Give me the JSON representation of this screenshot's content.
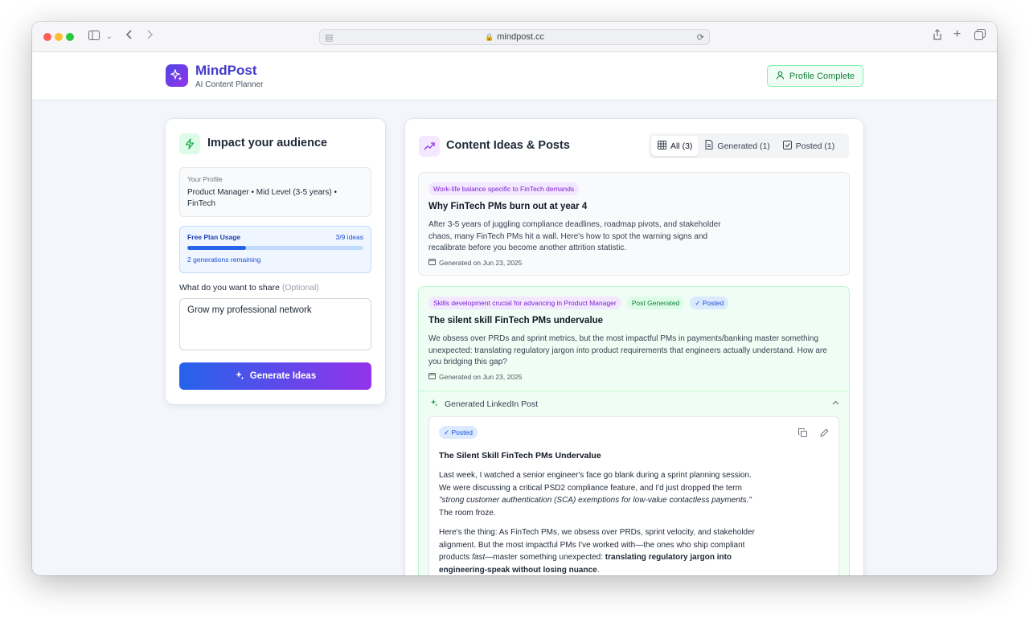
{
  "browser": {
    "url": "mindpost.cc"
  },
  "header": {
    "brand_title": "MindPost",
    "brand_subtitle": "AI Content Planner",
    "profile_button": "Profile Complete"
  },
  "left_panel": {
    "title": "Impact your audience",
    "profile_label": "Your Profile",
    "profile_value": "Product Manager • Mid Level (3-5 years) • FinTech",
    "usage_title": "Free Plan Usage",
    "usage_count": "3/9 ideas",
    "usage_fraction": 0.3333,
    "usage_remaining": "2 generations remaining",
    "share_label": "What do you want to share",
    "share_optional": "(Optional)",
    "share_value": "Grow my professional network",
    "generate_button": "Generate Ideas"
  },
  "right_panel": {
    "title": "Content Ideas & Posts",
    "tabs": [
      {
        "label": "All (3)"
      },
      {
        "label": "Generated (1)"
      },
      {
        "label": "Posted (1)"
      }
    ],
    "ideas": [
      {
        "tag": "Work-life balance specific to FinTech demands",
        "title": "Why FinTech PMs burn out at year 4",
        "body": "After 3-5 years of juggling compliance deadlines, roadmap pivots, and stakeholder chaos, many FinTech PMs hit a wall. Here's how to spot the warning signs and recalibrate before you become another attrition statistic.",
        "date": "Generated on Jun 23, 2025"
      },
      {
        "tag": "Skills development crucial for advancing in Product Manager",
        "status_generated": "Post Generated",
        "status_posted": "✓ Posted",
        "title": "The silent skill FinTech PMs undervalue",
        "body": "We obsess over PRDs and sprint metrics, but the most impactful PMs in payments/banking master something unexpected: translating regulatory jargon into product requirements that engineers actually understand. How are you bridging this gap?",
        "date": "Generated on Jun 23, 2025",
        "generated_header": "Generated LinkedIn Post",
        "post": {
          "badge": "✓ Posted",
          "title": "The Silent Skill FinTech PMs Undervalue",
          "p1_a": "Last week, I watched a senior engineer's face go blank during a sprint planning session. We were discussing a critical PSD2 compliance feature, and I'd just dropped the term ",
          "p1_i": "\"strong customer authentication (SCA) exemptions for low-value contactless payments.\"",
          "p1_b": " The room froze.",
          "p2_a": "Here's the thing: As FinTech PMs, we obsess over PRDs, sprint velocity, and stakeholder alignment. But the most impactful PMs I've worked with—the ones who ship compliant products ",
          "p2_i": "fast",
          "p2_b": "—master something unexpected: ",
          "p2_bold": "translating regulatory jargon into engineering-speak without losing nuance",
          "p2_c": "."
        }
      }
    ]
  },
  "colors": {
    "brand": "#4338ca",
    "accent_green": "#15803d",
    "accent_blue": "#2563eb",
    "accent_purple": "#9333ea"
  }
}
